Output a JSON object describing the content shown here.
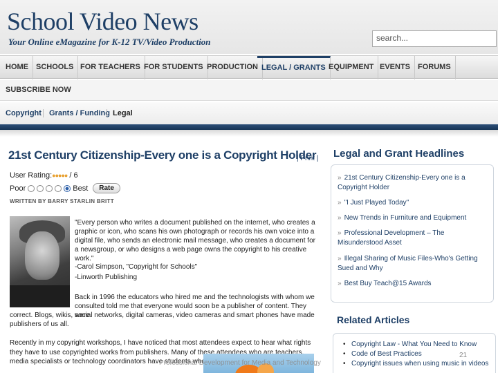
{
  "site": {
    "title": "School Video News",
    "tagline": "Your Online eMagazine for K-12 TV/Video Production",
    "search_placeholder": "search..."
  },
  "nav": {
    "items": [
      "HOME",
      "SCHOOLS",
      "FOR TEACHERS",
      "FOR STUDENTS",
      "PRODUCTION",
      "LEGAL / GRANTS",
      "EQUIPMENT",
      "EVENTS",
      "FORUMS"
    ],
    "active": "LEGAL / GRANTS",
    "subscribe": "SUBSCRIBE NOW"
  },
  "subnav": {
    "items": [
      "Copyright",
      "Grants / Funding",
      "Legal"
    ]
  },
  "article": {
    "title": "21st Century Citizenship-Every one is a Copyright Holder",
    "print": "| Print |",
    "rating_label": "User Rating:",
    "rating_suffix": "/ 6",
    "rating_stars": "●●●●●",
    "poor": "Poor",
    "best": "Best",
    "rate_button": "Rate",
    "byline": "WRITTEN BY BARRY STARLIN BRITT",
    "quote": "\"Every person who writes a document published on the internet, who creates a graphic or icon, who scans his own photograph or records his own voice into a digital file, who sends an electronic mail message, who creates a document for a newsgroup, or who designs a web page owns the copyright to his creative work.\"",
    "cite1": "-Carol Simpson, \"Copyright for Schools\"",
    "cite2": "-Linworth Publishing",
    "para1a": "Back in 1996 the educators who hired me and the technologists with whom we consulted told me that everyone would soon be a publisher of content. They were",
    "para1b": "correct. Blogs, wikis, social networks, digital cameras, video cameras and smart phones have made publishers of us all.",
    "para2": "Recently in my copyright workshops, I have noticed that most attendees expect to hear what rights they have to use copyrighted works from publishers. Many of these attendees who are teachers, media specialists or technology coordinators have students who are doing video yearbooks"
  },
  "sidebar": {
    "headlines_title": "Legal and Grant Headlines",
    "headlines": [
      "21st Century Citizenship-Every one is a Copyright Holder",
      "\"I Just Played Today\"",
      "New Trends in Furniture and Equipment",
      "Professional Development – The Misunderstood Asset",
      "Illegal Sharing of Music Files-Who's Getting Sued and Why",
      "Best Buy Teach@15 Awards"
    ],
    "related_title": "Related Articles",
    "related": [
      "Copyright Law - What You Need to Know",
      "Code of Best Practices",
      "Copyright issues when using music in videos"
    ]
  },
  "slide": {
    "footer": "Professional Development for Media and Technology",
    "number": "21"
  },
  "colors": {
    "brand": "#1e3f66",
    "star": "#e8a030",
    "bar": "#173556"
  }
}
